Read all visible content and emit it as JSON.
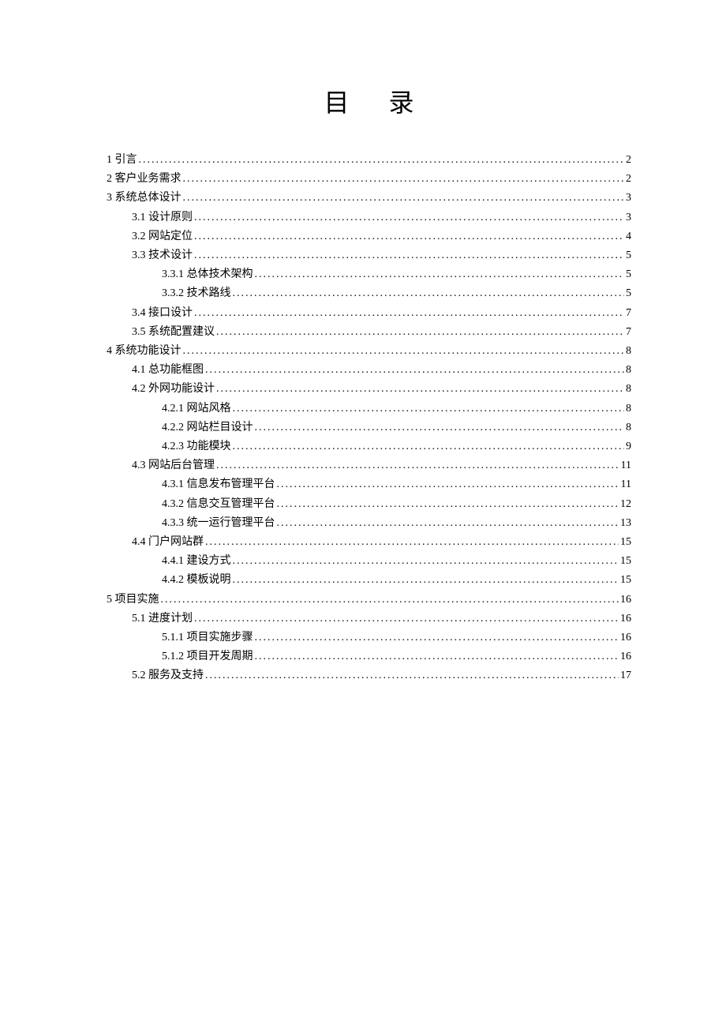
{
  "title": "目录",
  "toc": [
    {
      "level": 0,
      "label": "1  引言",
      "page": "2"
    },
    {
      "level": 0,
      "label": "2  客户业务需求",
      "page": "2"
    },
    {
      "level": 0,
      "label": "3  系统总体设计",
      "page": "3"
    },
    {
      "level": 1,
      "label": "3.1  设计原则",
      "page": "3"
    },
    {
      "level": 1,
      "label": "3.2  网站定位",
      "page": "4"
    },
    {
      "level": 1,
      "label": "3.3  技术设计",
      "page": "5"
    },
    {
      "level": 2,
      "label": "3.3.1  总体技术架构",
      "page": "5"
    },
    {
      "level": 2,
      "label": "3.3.2  技术路线",
      "page": "5"
    },
    {
      "level": 1,
      "label": "3.4  接口设计",
      "page": "7"
    },
    {
      "level": 1,
      "label": "3.5  系统配置建议",
      "page": "7"
    },
    {
      "level": 0,
      "label": "4  系统功能设计",
      "page": "8"
    },
    {
      "level": 1,
      "label": "4.1  总功能框图",
      "page": "8"
    },
    {
      "level": 1,
      "label": "4.2  外网功能设计",
      "page": "8"
    },
    {
      "level": 2,
      "label": "4.2.1  网站风格",
      "page": "8"
    },
    {
      "level": 2,
      "label": "4.2.2  网站栏目设计",
      "page": "8"
    },
    {
      "level": 2,
      "label": "4.2.3  功能模块",
      "page": "9"
    },
    {
      "level": 1,
      "label": "4.3  网站后台管理",
      "page": "11"
    },
    {
      "level": 2,
      "label": "4.3.1  信息发布管理平台",
      "page": "11"
    },
    {
      "level": 2,
      "label": "4.3.2  信息交互管理平台",
      "page": "12"
    },
    {
      "level": 2,
      "label": "4.3.3  统一运行管理平台",
      "page": "13"
    },
    {
      "level": 1,
      "label": "4.4  门户网站群",
      "page": "15"
    },
    {
      "level": 2,
      "label": "4.4.1  建设方式",
      "page": "15"
    },
    {
      "level": 2,
      "label": "4.4.2  模板说明",
      "page": "15"
    },
    {
      "level": 0,
      "label": "5  项目实施",
      "page": "16"
    },
    {
      "level": 1,
      "label": "5.1  进度计划",
      "page": "16"
    },
    {
      "level": 2,
      "label": "5.1.1  项目实施步骤",
      "page": "16"
    },
    {
      "level": 2,
      "label": "5.1.2  项目开发周期",
      "page": "16"
    },
    {
      "level": 1,
      "label": "5.2  服务及支持",
      "page": "17"
    }
  ]
}
